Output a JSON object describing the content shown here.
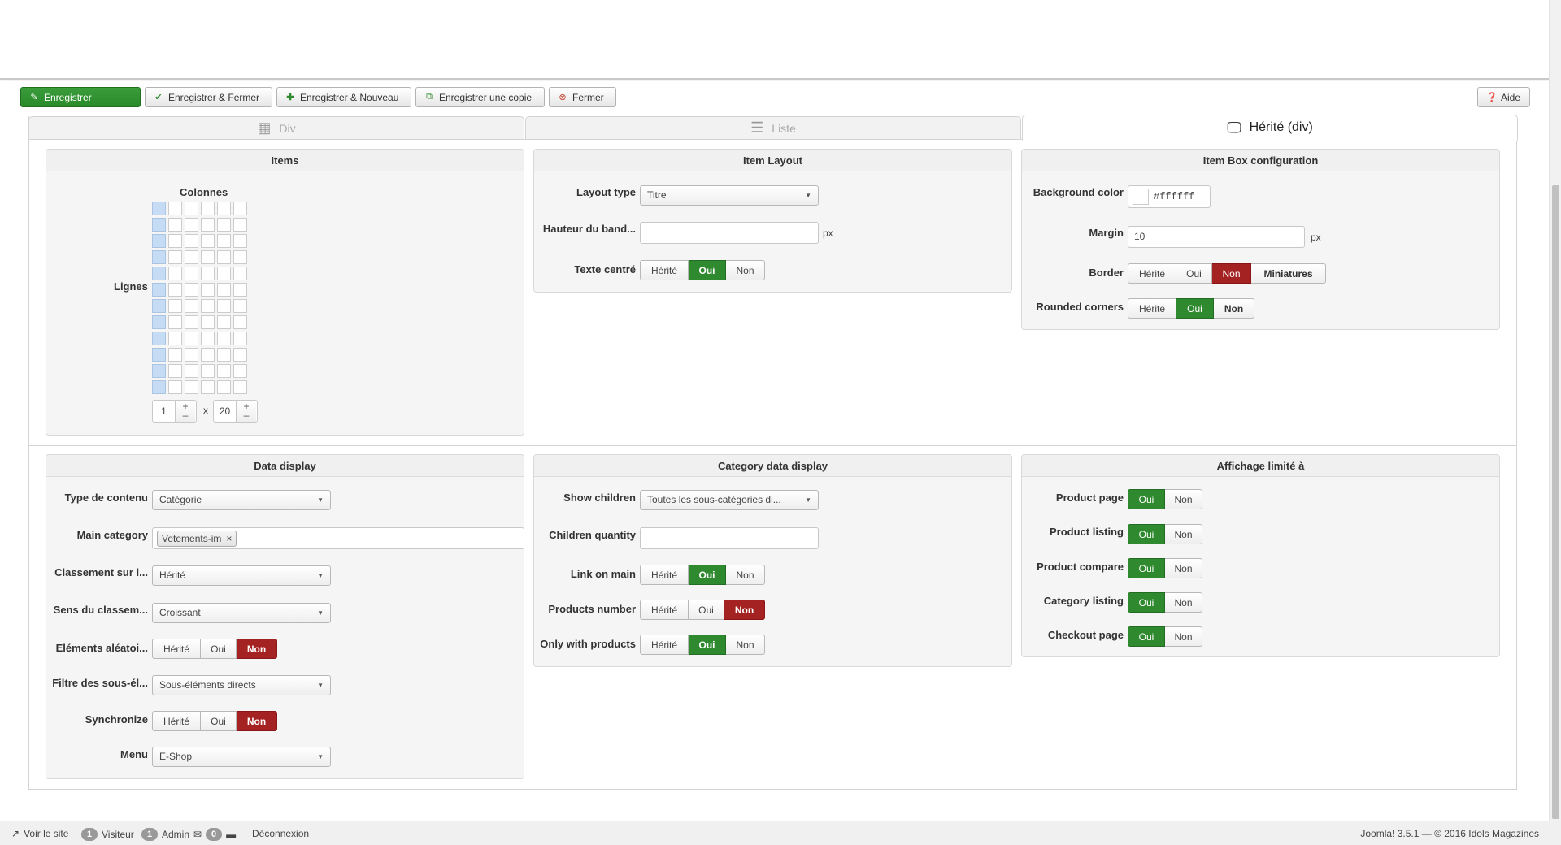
{
  "toolbar": {
    "save": "Enregistrer",
    "save_close": "Enregistrer & Fermer",
    "save_new": "Enregistrer & Nouveau",
    "save_copy": "Enregistrer une copie",
    "close": "Fermer",
    "help": "Aide"
  },
  "tabs": [
    {
      "label": "Div"
    },
    {
      "label": "Liste"
    },
    {
      "label": "Hérité (div)"
    }
  ],
  "items_panel": {
    "title": "Items",
    "columns_label": "Colonnes",
    "rows_label": "Lignes",
    "columns_value": "1",
    "times": "x",
    "rows_value": "20",
    "plus": "+",
    "minus": "–",
    "grid_rows": 12,
    "grid_cols": 6,
    "selected_cols": 1
  },
  "item_layout": {
    "title": "Item Layout",
    "layout_type_label": "Layout type",
    "layout_type_value": "Titre",
    "band_height_label": "Hauteur du band...",
    "band_height_value": "",
    "unit": "px",
    "centered_text_label": "Texte centré",
    "opt_inherit": "Hérité",
    "opt_yes": "Oui",
    "opt_no": "Non"
  },
  "item_box": {
    "title": "Item Box configuration",
    "bg_color_label": "Background color",
    "bg_color_value": "#ffffff",
    "margin_label": "Margin",
    "margin_value": "10",
    "unit": "px",
    "border_label": "Border",
    "opt_inherit": "Hérité",
    "opt_yes": "Oui",
    "opt_no": "Non",
    "opt_thumbs": "Miniatures",
    "rounded_label": "Rounded corners"
  },
  "data_display": {
    "title": "Data display",
    "content_type_label": "Type de contenu",
    "content_type_value": "Catégorie",
    "main_category_label": "Main category",
    "main_category_tag": "Vetements-im",
    "tag_remove": "×",
    "sort_label": "Classement sur l...",
    "sort_value": "Hérité",
    "sort_dir_label": "Sens du classem...",
    "sort_dir_value": "Croissant",
    "random_label": "Eléments aléatoi...",
    "filter_label": "Filtre des sous-él...",
    "filter_value": "Sous-éléments directs",
    "sync_label": "Synchronize",
    "menu_label": "Menu",
    "menu_value": "E-Shop",
    "opt_inherit": "Hérité",
    "opt_yes": "Oui",
    "opt_no": "Non"
  },
  "category_display": {
    "title": "Category data display",
    "show_children_label": "Show children",
    "show_children_value": "Toutes les sous-catégories di...",
    "children_qty_label": "Children quantity",
    "children_qty_value": "",
    "link_main_label": "Link on main",
    "products_number_label": "Products number",
    "only_products_label": "Only with products",
    "opt_inherit": "Hérité",
    "opt_yes": "Oui",
    "opt_no": "Non"
  },
  "display_limited": {
    "title": "Affichage limité à",
    "product_page": "Product page",
    "product_listing": "Product listing",
    "product_compare": "Product compare",
    "category_listing": "Category listing",
    "checkout_page": "Checkout page",
    "opt_yes": "Oui",
    "opt_no": "Non"
  },
  "status": {
    "view_site": "Voir le site",
    "visitors_count": "1",
    "visitors": "Visiteur",
    "admin_count": "1",
    "admin": "Admin",
    "messages_count": "0",
    "logout": "Déconnexion",
    "version": "Joomla! 3.5.1 — © 2016 Idols Magazines"
  },
  "colors": {
    "green": "#2f8a2f",
    "red": "#a52222",
    "cell_selected": "#c6dcf4"
  }
}
